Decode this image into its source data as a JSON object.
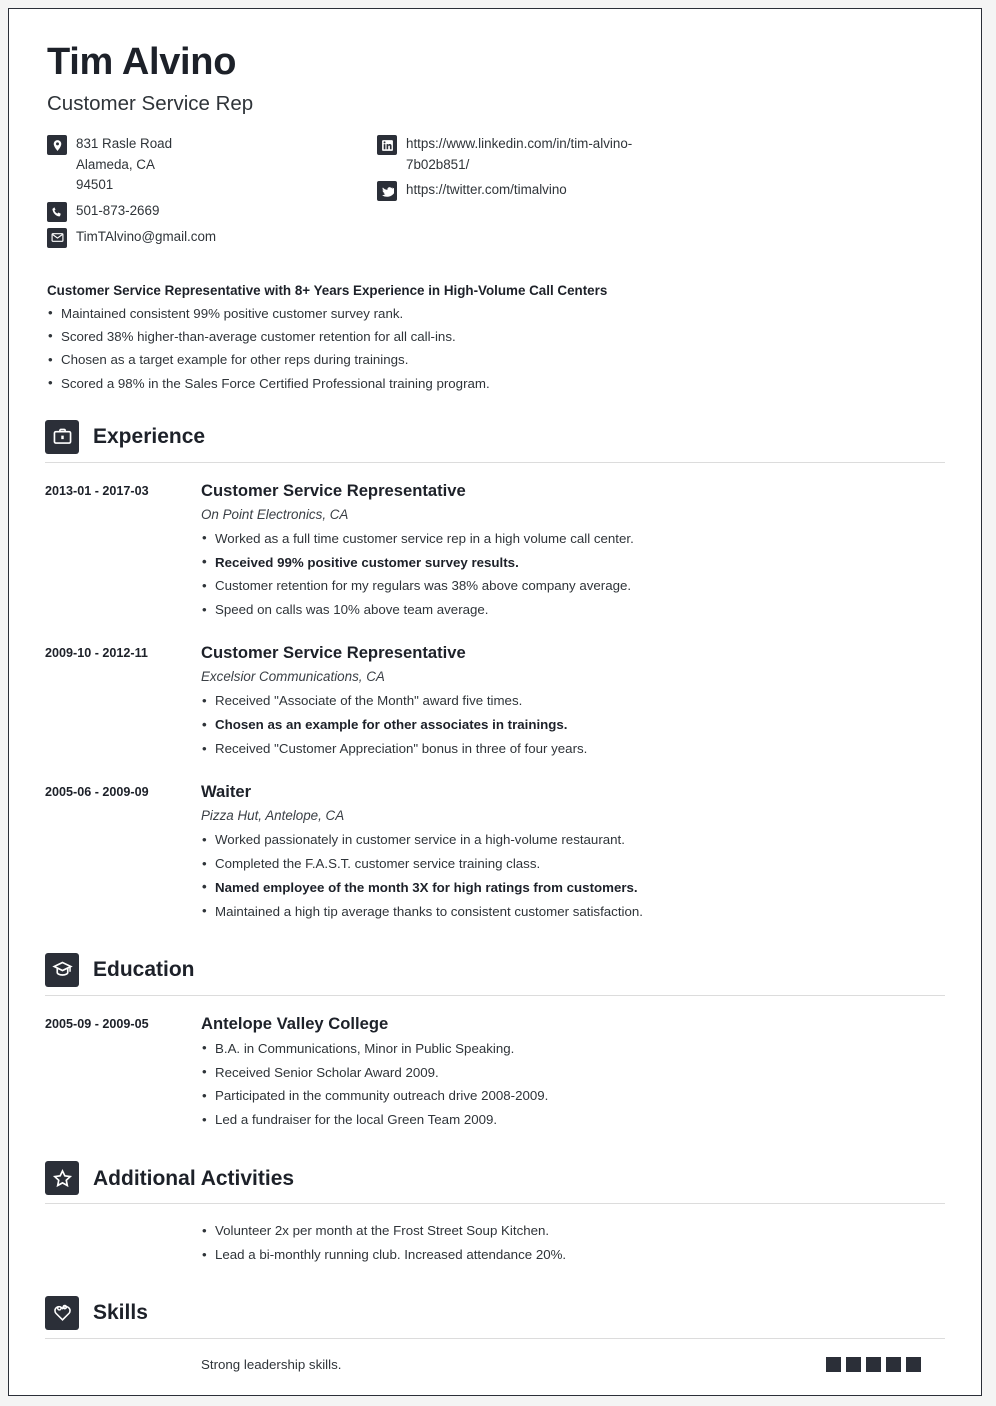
{
  "theme": {
    "ink": "#1d2129",
    "body_text": "#2f3439",
    "icon_bg": "#2b2f38",
    "rule": "#dcdcdc",
    "page_bg": "#ffffff"
  },
  "header": {
    "name": "Tim Alvino",
    "job_title": "Customer Service Rep",
    "contact_left": [
      {
        "icon": "map-pin-icon",
        "text": "831 Rasle Road",
        "line2": "Alameda, CA",
        "line3": "94501"
      },
      {
        "icon": "phone-icon",
        "text": "501-873-2669"
      },
      {
        "icon": "envelope-icon",
        "text": "TimTAlvino@gmail.com"
      }
    ],
    "contact_right": [
      {
        "icon": "linkedin-icon",
        "text": "https://www.linkedin.com/in/tim-alvino-7b02b851/"
      },
      {
        "icon": "twitter-icon",
        "text": "https://twitter.com/timalvino"
      }
    ]
  },
  "summary": {
    "headline": "Customer Service Representative with 8+ Years Experience in High-Volume Call Centers",
    "bullets": [
      "Maintained consistent 99% positive customer survey rank.",
      "Scored 38% higher-than-average customer retention for all call-ins.",
      "Chosen as a target example for other reps during trainings.",
      "Scored a 98% in the Sales Force Certified Professional training program."
    ]
  },
  "sections": {
    "experience": {
      "title": "Experience",
      "icon": "briefcase-icon",
      "entries": [
        {
          "date": "2013-01 - 2017-03",
          "title": "Customer Service Representative",
          "subtitle": "On Point Electronics, CA",
          "bullets": [
            {
              "text": "Worked as a full time customer service rep in a high volume call center.",
              "bold": false
            },
            {
              "text": "Received 99% positive customer survey results.",
              "bold": true
            },
            {
              "text": "Customer retention for my regulars was 38% above company average.",
              "bold": false
            },
            {
              "text": "Speed on calls was 10% above team average.",
              "bold": false
            }
          ]
        },
        {
          "date": "2009-10 - 2012-11",
          "title": "Customer Service Representative",
          "subtitle": "Excelsior Communications, CA",
          "bullets": [
            {
              "text": "Received \"Associate of the Month\" award five times.",
              "bold": false
            },
            {
              "text": "Chosen as an example for other associates in trainings.",
              "bold": true
            },
            {
              "text": "Received \"Customer Appreciation\" bonus in three of four years.",
              "bold": false
            }
          ]
        },
        {
          "date": "2005-06 - 2009-09",
          "title": "Waiter",
          "subtitle": "Pizza Hut, Antelope, CA",
          "bullets": [
            {
              "text": "Worked passionately in customer service in a high-volume restaurant.",
              "bold": false
            },
            {
              "text": "Completed the F.A.S.T. customer service training class.",
              "bold": false
            },
            {
              "text": "Named employee of the month 3X for high ratings from customers.",
              "bold": true
            },
            {
              "text": "Maintained a high tip average thanks to consistent customer satisfaction.",
              "bold": false
            }
          ]
        }
      ]
    },
    "education": {
      "title": "Education",
      "icon": "graduation-cap-icon",
      "entries": [
        {
          "date": "2005-09 - 2009-05",
          "title": "Antelope Valley College",
          "bullets": [
            {
              "text": "B.A. in Communications, Minor in Public Speaking.",
              "bold": false
            },
            {
              "text": "Received Senior Scholar Award 2009.",
              "bold": false
            },
            {
              "text": "Participated in the community outreach drive 2008-2009.",
              "bold": false
            },
            {
              "text": "Led a fundraiser for the local Green Team 2009.",
              "bold": false
            }
          ]
        }
      ]
    },
    "activities": {
      "title": "Additional Activities",
      "icon": "star-icon",
      "bullets": [
        {
          "text": "Volunteer 2x per month at the Frost Street Soup Kitchen.",
          "bold": false
        },
        {
          "text": "Lead a bi-monthly running club. Increased attendance 20%.",
          "bold": false
        }
      ]
    },
    "skills": {
      "title": "Skills",
      "icon": "skill-heart-icon",
      "items": [
        {
          "name": "Strong leadership skills.",
          "rating": 5,
          "max": 5
        }
      ]
    }
  }
}
